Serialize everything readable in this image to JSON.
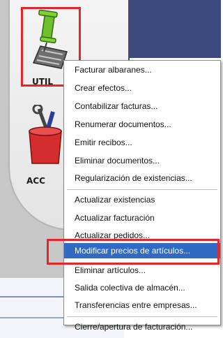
{
  "launcher": {
    "util_label": "UTIL",
    "acc_label": "ACC"
  },
  "menu": {
    "groups": [
      [
        "Facturar albaranes...",
        "Crear efectos...",
        "Contabilizar facturas...",
        "Renumerar documentos...",
        "Emitir recibos...",
        "Eliminar documentos...",
        "Regularización de existencias..."
      ],
      [
        "Actualizar existencias",
        "Actualizar facturación",
        "Actualizar pedidos...",
        "Modificar precios de artículos...",
        "Eliminar artículos...",
        "Salida colectiva de almacén...",
        "Transferencias entre empresas..."
      ],
      [
        "Cierre/apertura de facturación..."
      ]
    ],
    "selected": "Modificar precios de artículos..."
  }
}
